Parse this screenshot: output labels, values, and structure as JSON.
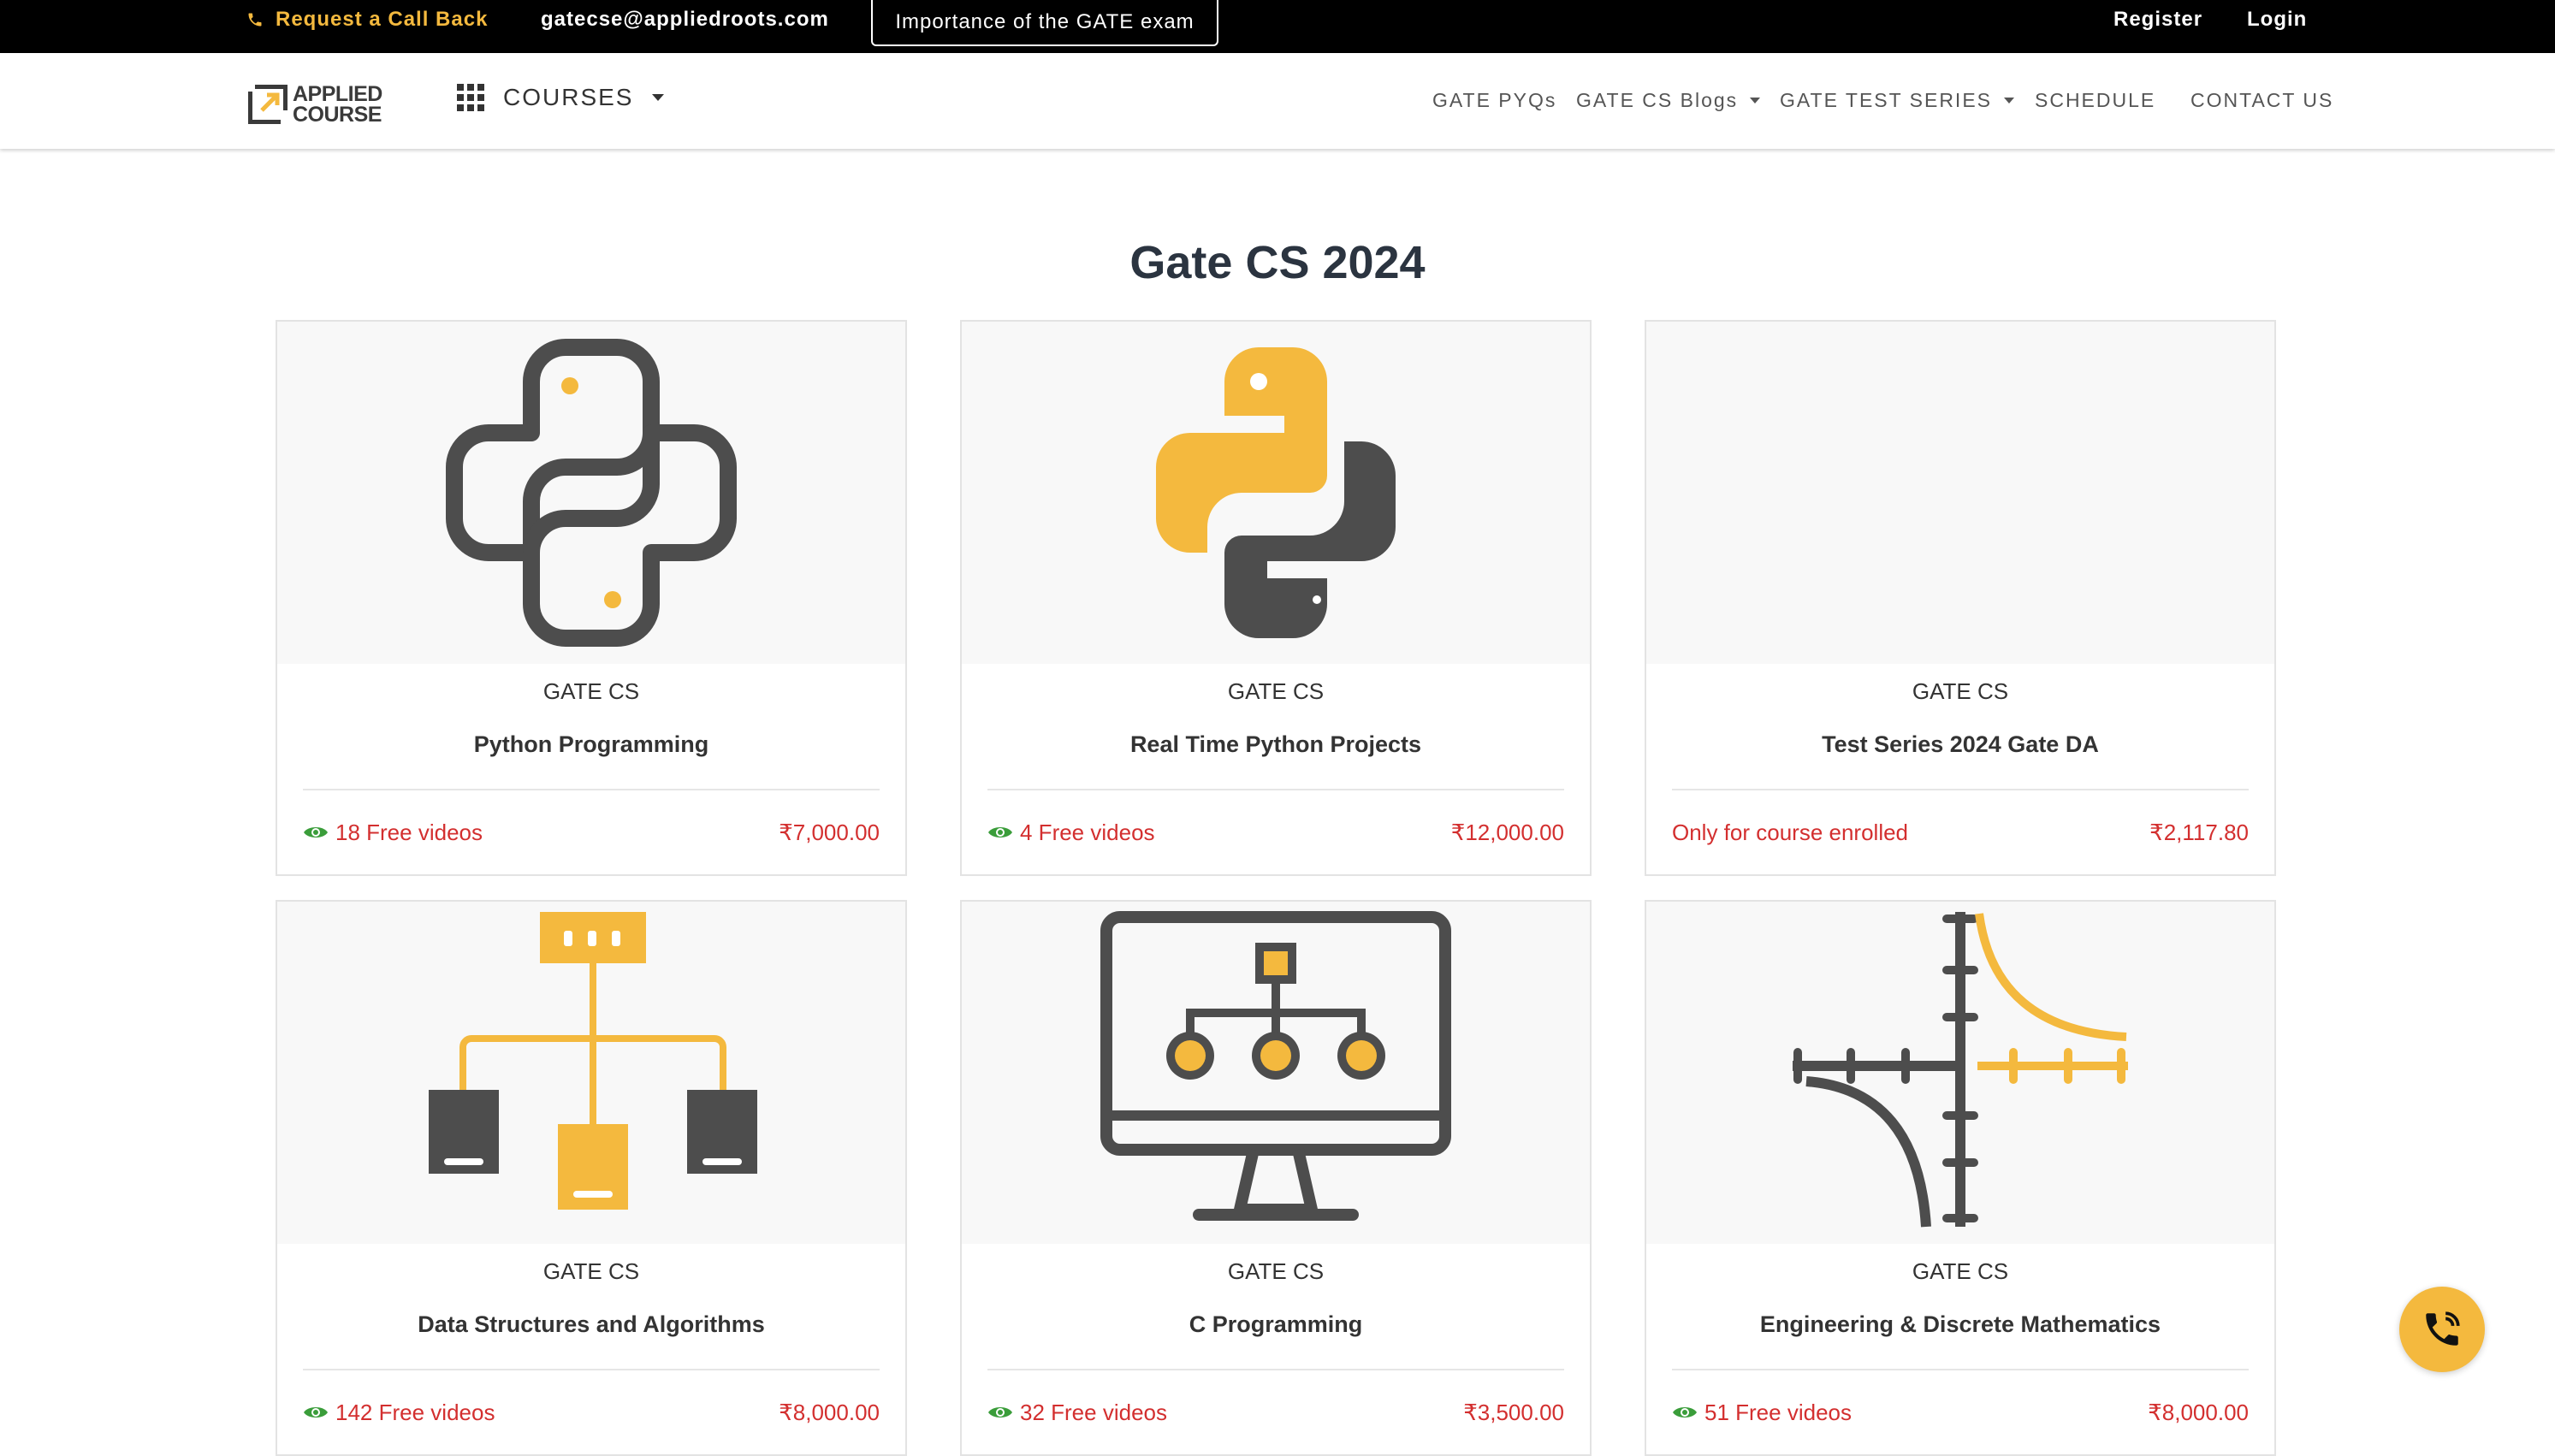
{
  "topbar": {
    "callback": "Request a Call Back",
    "email": "gatecse@appliedroots.com",
    "importance": "Importance of the GATE exam",
    "register": "Register",
    "login": "Login"
  },
  "nav": {
    "logo_line1": "APPLIED",
    "logo_line2": "COURSE",
    "courses": "COURSES",
    "links": [
      "GATE PYQs",
      "GATE CS Blogs",
      "GATE TEST SERIES",
      "SCHEDULE",
      "CONTACT US"
    ]
  },
  "page": {
    "title": "Gate CS 2024"
  },
  "cards": [
    {
      "category": "GATE CS",
      "title": "Python Programming",
      "free": "18 Free videos",
      "price": "₹7,000.00",
      "icon": "python-outline-icon"
    },
    {
      "category": "GATE CS",
      "title": "Real Time Python Projects",
      "free": "4 Free videos",
      "price": "₹12,000.00",
      "icon": "python-logo-icon"
    },
    {
      "category": "GATE CS",
      "title": "Test Series 2024 Gate DA",
      "free": "Only for course enrolled",
      "price": "₹2,117.80",
      "icon": ""
    },
    {
      "category": "GATE CS",
      "title": "Data Structures and Algorithms",
      "free": "142 Free videos",
      "price": "₹8,000.00",
      "icon": "tree-diagram-icon"
    },
    {
      "category": "GATE CS",
      "title": "C Programming",
      "free": "32 Free videos",
      "price": "₹3,500.00",
      "icon": "monitor-hierarchy-icon"
    },
    {
      "category": "GATE CS",
      "title": "Engineering & Discrete Mathematics",
      "free": "51 Free videos",
      "price": "₹8,000.00",
      "icon": "hyperbola-graph-icon"
    }
  ],
  "colors": {
    "accent": "#f4b93e",
    "dark": "#4d4d4d",
    "price": "#d32f2f",
    "eye": "#3a9d3a"
  }
}
